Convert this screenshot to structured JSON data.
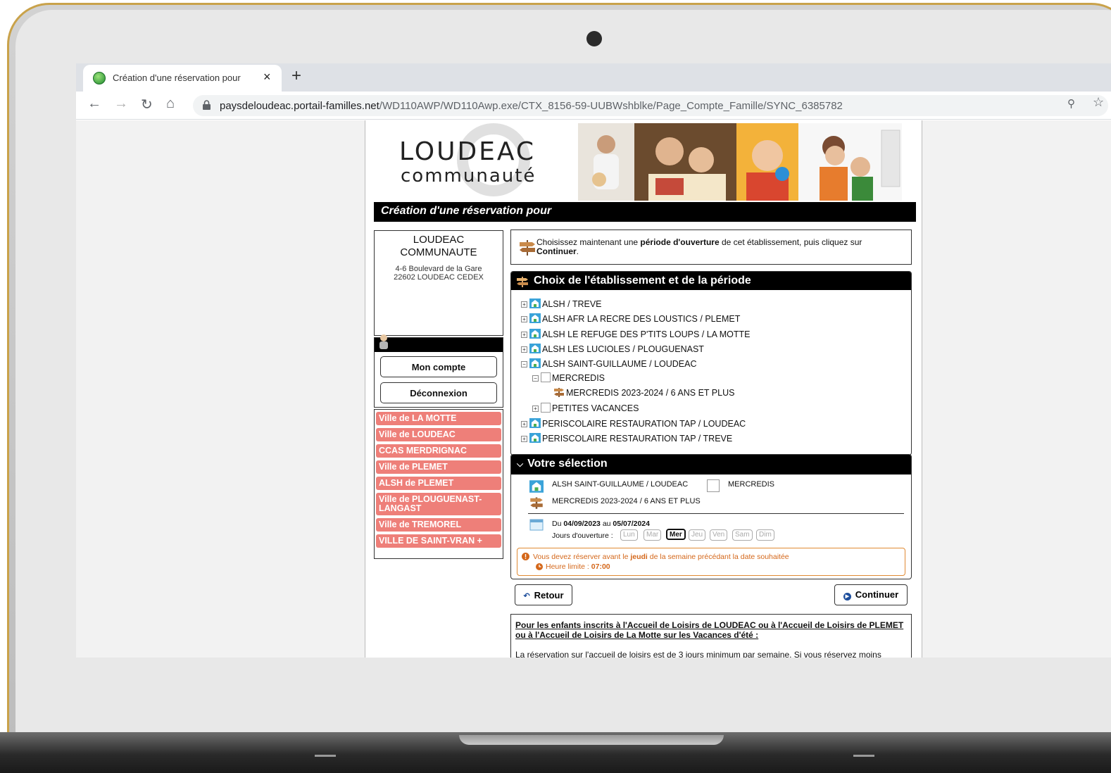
{
  "browser": {
    "tab_title": "Création d'une réservation pour",
    "tab_close": "×",
    "new_tab": "+",
    "url_host": "paysdeloudeac.portail-familles.net",
    "url_path": "/WD110AWP/WD110Awp.exe/CTX_8156-59-UUBWshblke/Page_Compte_Famille/SYNC_6385782"
  },
  "banner": {
    "logo_line1": "LOUDEAC",
    "logo_line2": "communauté"
  },
  "page_title": "Création d'une réservation pour",
  "organization": {
    "name": "LOUDEAC COMMUNAUTE",
    "address_line1": "4-6 Boulevard de la Gare",
    "address_line2": "22602 LOUDEAC CEDEX"
  },
  "account": {
    "my_account_label": "Mon compte",
    "logout_label": "Déconnexion"
  },
  "org_links": [
    "Ville de LA MOTTE",
    "Ville de LOUDEAC",
    "CCAS MERDRIGNAC",
    "Ville de PLEMET",
    "ALSH de PLEMET",
    "Ville de PLOUGUENAST-LANGAST",
    "Ville de TREMOREL",
    "VILLE DE SAINT-VRAN +"
  ],
  "instruction": {
    "part1": "Choisissez maintenant une ",
    "bold1": "période d'ouverture",
    "part2": " de cet établissement, puis cliquez sur ",
    "bold2": "Continuer",
    "part3": "."
  },
  "tree": {
    "header": "Choix de l'établissement et de la période",
    "items": [
      "ALSH / TREVE",
      "ALSH AFR LA RECRE DES LOUSTICS / PLEMET",
      "ALSH LE REFUGE DES P'TITS LOUPS / LA MOTTE",
      "ALSH LES LUCIOLES / PLOUGUENAST",
      "ALSH SAINT-GUILLAUME / LOUDEAC",
      "MERCREDIS",
      "MERCREDIS 2023-2024 / 6 ANS ET PLUS",
      "PETITES VACANCES",
      "PERISCOLAIRE RESTAURATION TAP / LOUDEAC",
      "PERISCOLAIRE RESTAURATION TAP / TREVE"
    ]
  },
  "selection": {
    "header": "Votre sélection",
    "site": "ALSH SAINT-GUILLAUME / LOUDEAC",
    "category": "MERCREDIS",
    "period": "MERCREDIS 2023-2024 / 6 ANS ET PLUS",
    "date_prefix": "Du ",
    "date_start": "04/09/2023",
    "date_mid": " au ",
    "date_end": "05/07/2024",
    "opening_days_label": "Jours d'ouverture :",
    "days": [
      "Lun",
      "Mar",
      "Mer",
      "Jeu",
      "Ven",
      "Sam",
      "Dim"
    ],
    "active_day": "Mer",
    "warning_part1": "Vous devez réserver avant le ",
    "warning_bold": "jeudi",
    "warning_part2": " de la semaine précédant la date souhaitée",
    "deadline_label": "Heure limite : ",
    "deadline_time": "07:00"
  },
  "actions": {
    "back_label": "Retour",
    "continue_label": "Continuer"
  },
  "info": {
    "heading": "Pour les enfants inscrits à l'Accueil de Loisirs de LOUDEAC ou à l'Accueil de Loisirs de PLEMET ou à l'Accueil de Loisirs de La Motte sur les Vacances d'été :",
    "body": "La réservation sur l'accueil de loisirs est de 3 jours minimum par semaine. Si vous réservez moins"
  },
  "colors": {
    "org_link_bg": "#ee7f79",
    "warning": "#d4671a",
    "header_bg": "#000000",
    "laptop_frame": "#c9a24a"
  }
}
